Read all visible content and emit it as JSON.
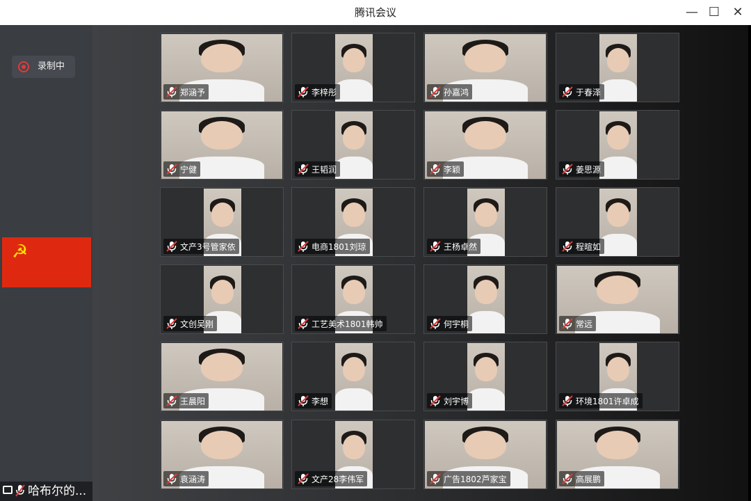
{
  "window": {
    "title": "腾讯会议"
  },
  "titlebar_buttons": {
    "minimize": "—",
    "maximize": "☐",
    "close": "✕"
  },
  "recording": {
    "label": "录制中",
    "color": "#e03a3a"
  },
  "flag": {
    "color": "#de2910",
    "emblem": "☭",
    "emblem_color": "#ffde00"
  },
  "self_view": {
    "name": "哈布尔的..."
  },
  "participants": [
    {
      "name": "郑涵予",
      "video": "wide"
    },
    {
      "name": "李梓彤",
      "video": "narrow"
    },
    {
      "name": "孙嘉鸿",
      "video": "wide"
    },
    {
      "name": "于春泽",
      "video": "narrow"
    },
    {
      "name": "宁健",
      "video": "wide"
    },
    {
      "name": "王韬润",
      "video": "narrow"
    },
    {
      "name": "李颖",
      "video": "wide"
    },
    {
      "name": "姜思源",
      "video": "narrow"
    },
    {
      "name": "文产3号管家依",
      "video": "narrow"
    },
    {
      "name": "电商1801刘琼",
      "video": "narrow"
    },
    {
      "name": "王杨卓然",
      "video": "narrow"
    },
    {
      "name": "程暄如",
      "video": "narrow"
    },
    {
      "name": "文创吴刚",
      "video": "narrow"
    },
    {
      "name": "工艺美术1801韩帅",
      "video": "narrow"
    },
    {
      "name": "何宇桐",
      "video": "narrow"
    },
    {
      "name": "常远",
      "video": "wide"
    },
    {
      "name": "王晨阳",
      "video": "wide"
    },
    {
      "name": "李想",
      "video": "narrow"
    },
    {
      "name": "刘宇博",
      "video": "narrow"
    },
    {
      "name": "环境1801许卓成",
      "video": "narrow"
    },
    {
      "name": "袁涵涛",
      "video": "wide"
    },
    {
      "name": "文产28李伟军",
      "video": "narrow"
    },
    {
      "name": "广告1802芦家宝",
      "video": "wide"
    },
    {
      "name": "高展鹏",
      "video": "wide"
    }
  ]
}
